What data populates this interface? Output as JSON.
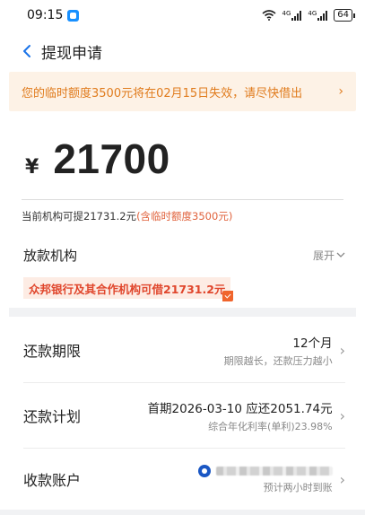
{
  "status_bar": {
    "time": "09:15",
    "network1": "4G",
    "network2": "4G",
    "battery": "64"
  },
  "nav": {
    "title": "提现申请"
  },
  "banner": {
    "text": "您的临时额度3500元将在02月15日失效，请尽快借出",
    "arrow": "›"
  },
  "amount": {
    "currency": "¥",
    "value": "21700"
  },
  "available": {
    "prefix": "当前机构可提21731.2元",
    "highlight": "(含临时额度3500元)"
  },
  "lender": {
    "label": "放款机构",
    "expand_label": "展开",
    "tag": "众邦银行及其合作机构可借21731.2元"
  },
  "rows": {
    "term": {
      "label": "还款期限",
      "value": "12个月",
      "sub": "期限越长，还款压力越小"
    },
    "plan": {
      "label": "还款计划",
      "value": "首期2026-03-10 应还2051.74元",
      "sub": "综合年化利率(单利)23.98%"
    },
    "account": {
      "label": "收款账户",
      "sub": "预计两小时到账"
    }
  },
  "colors": {
    "accent_orange": "#e07b1c",
    "highlight_red": "#e0623c",
    "tag_red": "#e0462c"
  }
}
